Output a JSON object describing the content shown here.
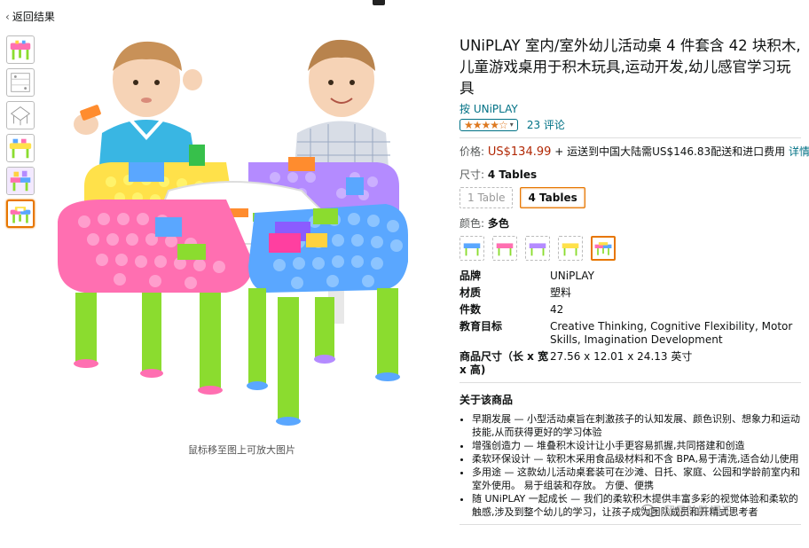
{
  "nav": {
    "back_label": "返回结果"
  },
  "thumbnails": [
    {
      "icon": "product-thumb-1"
    },
    {
      "icon": "product-thumb-2"
    },
    {
      "icon": "product-thumb-3"
    },
    {
      "icon": "product-thumb-4"
    },
    {
      "icon": "product-thumb-5"
    },
    {
      "icon": "product-thumb-6",
      "active": true
    }
  ],
  "image": {
    "hover_hint": "鼠标移至图上可放大图片"
  },
  "product": {
    "title": "UNiPLAY 室内/室外幼儿活动桌 4 件套含 42 块积木,儿童游戏桌用于积木玩具,运动开发,幼儿感官学习玩具",
    "byline": "按 UNiPLAY",
    "stars": "★★★★☆",
    "rating_value": 4.5,
    "review_count": "23 评论",
    "price_label": "价格:",
    "price": "US$134.99",
    "price_detail": "+ 运送到中国大陆需US$146.83配送和进口费用",
    "price_detail_link": "详情",
    "size_label": "尺寸:",
    "size_value": "4 Tables",
    "sizes": [
      "1 Table",
      "4 Tables"
    ],
    "color_label": "颜色:",
    "color_value": "多色",
    "specs": [
      {
        "key": "品牌",
        "value": "UNiPLAY"
      },
      {
        "key": "材质",
        "value": "塑料"
      },
      {
        "key": "件数",
        "value": "42"
      },
      {
        "key": "教育目标",
        "value": "Creative Thinking, Cognitive Flexibility, Motor Skills, Imagination Development"
      },
      {
        "key": "商品尺寸（长 x 宽 x 高)",
        "value": "27.56 x 12.01 x 24.13 英寸"
      }
    ],
    "about_title": "关于该商品",
    "bullets": [
      "早期发展 — 小型活动桌旨在刺激孩子的认知发展、颜色识别、想象力和运动技能,从而获得更好的学习体验",
      "增强创造力 — 堆叠积木设计让小手更容易抓握,共同搭建和创造",
      "柔软环保设计 — 软积木采用食品级材料和不含 BPA,易于清洗,适合幼儿使用",
      "多用途 — 这款幼儿活动桌套装可在沙滩、日托、家庭、公园和学龄前室内和室外使用。 易于组装和存放。 方便、便携",
      "随 UNiPLAY 一起成长 — 我们的柔软积木提供丰富多彩的视觉体验和柔软的触感,涉及到整个幼儿的学习，让孩子成为团队成员和开精式思考者"
    ]
  },
  "watermark": {
    "text": "贸易防跌闻讯",
    "icon": "wechat-icon"
  },
  "colors": {
    "link": "#007185",
    "price": "#b12704",
    "accent": "#e77600",
    "star": "#de7921"
  }
}
